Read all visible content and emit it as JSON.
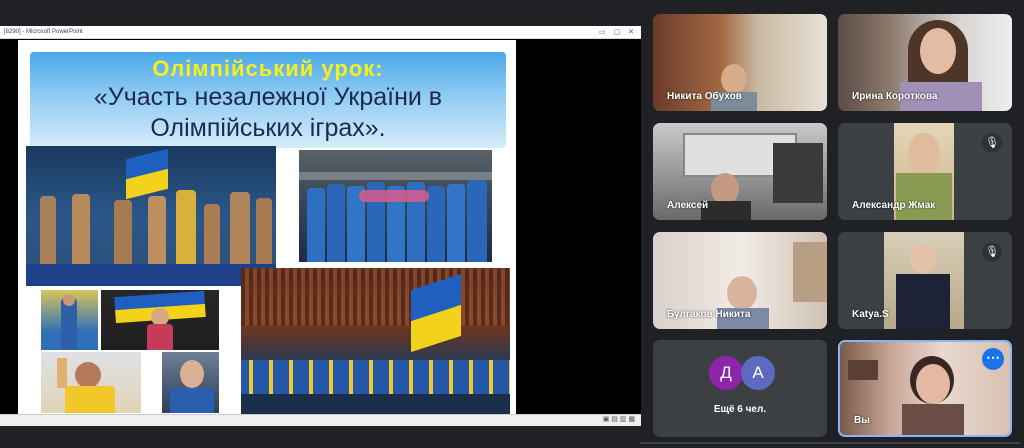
{
  "window": {
    "title": "[8290] - Microsoft PowerPoint",
    "controls": "▭ ▢ ✕"
  },
  "slide": {
    "title_line1": "Олімпійський урок:",
    "title_line2": "«Участь незалежної України в",
    "title_line3": "Олімпійських іграх»."
  },
  "participants": [
    {
      "name": "Никита Обухов",
      "muted": false
    },
    {
      "name": "Ирина Короткова",
      "muted": false
    },
    {
      "name": "Алексей",
      "muted": false
    },
    {
      "name": "Александр Жмак",
      "muted": true
    },
    {
      "name": "Булгаков Никита",
      "muted": false
    },
    {
      "name": "Katya.S",
      "muted": true
    }
  ],
  "more_tile": {
    "avatars": [
      {
        "letter": "Д",
        "color": "#8e24aa"
      },
      {
        "letter": "А",
        "color": "#5c6bc0"
      }
    ],
    "label": "Ещё 6 чел."
  },
  "self_tile": {
    "name": "Вы",
    "menu_icon": "⋯"
  },
  "icons": {
    "mic_off": "🎙"
  },
  "colors": {
    "background": "#202124",
    "tile": "#3c4043",
    "accent": "#1a73e8",
    "self_border": "#8ab4f8"
  }
}
